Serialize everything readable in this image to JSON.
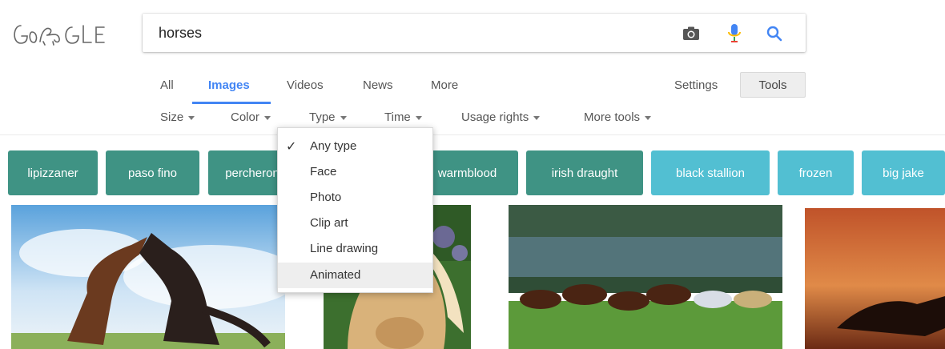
{
  "search": {
    "query": "horses"
  },
  "nav": {
    "tabs": [
      {
        "label": "All"
      },
      {
        "label": "Images",
        "active": true
      },
      {
        "label": "Videos"
      },
      {
        "label": "News"
      },
      {
        "label": "More"
      }
    ],
    "settings_label": "Settings",
    "tools_label": "Tools"
  },
  "filters": [
    {
      "label": "Size"
    },
    {
      "label": "Color"
    },
    {
      "label": "Type"
    },
    {
      "label": "Time"
    },
    {
      "label": "Usage rights"
    },
    {
      "label": "More tools"
    }
  ],
  "type_menu": {
    "options": [
      {
        "label": "Any type",
        "selected": true
      },
      {
        "label": "Face"
      },
      {
        "label": "Photo"
      },
      {
        "label": "Clip art"
      },
      {
        "label": "Line drawing"
      },
      {
        "label": "Animated",
        "hovered": true
      }
    ]
  },
  "chips": [
    {
      "label": "lipizzaner"
    },
    {
      "label": "paso fino"
    },
    {
      "label": "percheron"
    },
    {
      "label": "warmblood"
    },
    {
      "label": "irish draught"
    },
    {
      "label": "black stallion"
    },
    {
      "label": "frozen"
    },
    {
      "label": "big jake"
    }
  ],
  "colors": {
    "accent": "#4285f4",
    "chip_green": "#3f9384",
    "chip_blue": "#52bfd2"
  }
}
